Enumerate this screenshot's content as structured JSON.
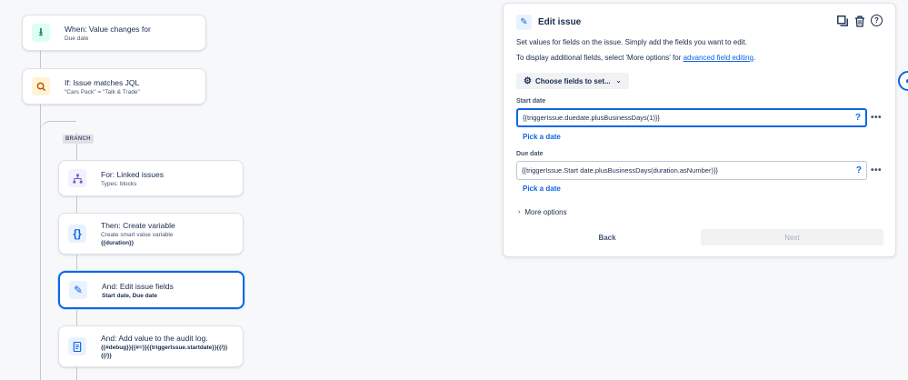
{
  "rule": {
    "trigger": {
      "title": "When: Value changes for",
      "subtitle": "Due date",
      "icon": "value-change-icon"
    },
    "condition": {
      "title": "If: Issue matches JQL",
      "subtitle": "\"Cars Pack\" = \"Talk & Trade\"",
      "icon": "search-icon"
    },
    "branch_label": "BRANCH",
    "branch_for": {
      "title": "For: Linked issues",
      "subtitle": "Types: blocks",
      "icon": "branch-icon"
    },
    "create_variable": {
      "title": "Then: Create variable",
      "subtitle": "Create smart value variable",
      "subtitle2": "{{duration}}",
      "icon": "braces-icon"
    },
    "edit_fields": {
      "title": "And: Edit issue fields",
      "subtitle": "Start date, Due date",
      "icon": "pencil-icon"
    },
    "audit_log": {
      "title": "And: Add value to the audit log.",
      "subtitle": "{{#debug}}{{#=}}{{triggerIssue.startdate}}{{/}}",
      "subtitle2": "{{/}}",
      "icon": "log-icon"
    }
  },
  "panel": {
    "title": "Edit issue",
    "description1": "Set values for fields on the issue. Simply add the fields you want to edit.",
    "description2_prefix": "To display additional fields, select 'More options' for ",
    "description2_link": "advanced field editing",
    "description2_suffix": ".",
    "choose_fields_label": "Choose fields to set...",
    "fields": [
      {
        "label": "Start date",
        "value": "{{triggerIssue.duedate.plusBusinessDays(1)}}",
        "help": "?",
        "more": "•••",
        "pick_label": "Pick a date"
      },
      {
        "label": "Due date",
        "value": "{{triggerIssue.Start date.plusBusinessDays(duration.asNumber)}}",
        "help": "?",
        "more": "•••",
        "pick_label": "Pick a date"
      }
    ],
    "more_options_label": "More options",
    "back_label": "Back",
    "next_label": "Next"
  },
  "colors": {
    "accent": "#0c66e4",
    "text": "#172b4d",
    "border": "#dfe1e6"
  }
}
